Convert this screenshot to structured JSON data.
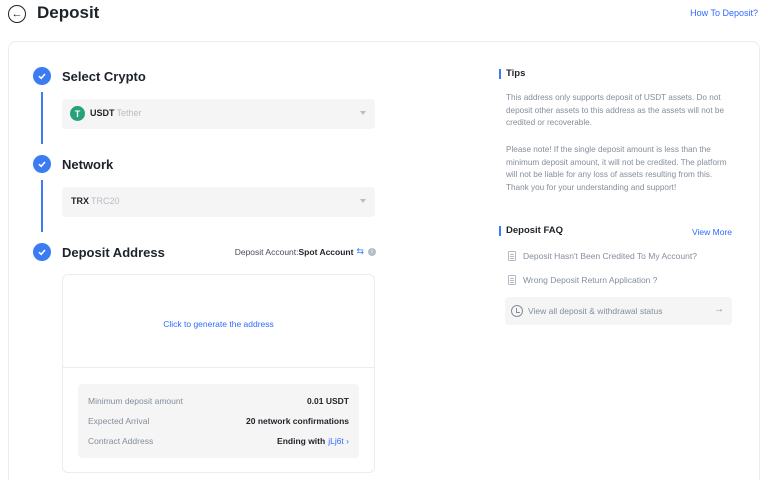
{
  "header": {
    "back_icon": "arrow-left-icon",
    "title": "Deposit",
    "how_to": "How To Deposit?"
  },
  "steps": {
    "select_crypto": {
      "title": "Select Crypto",
      "coin_symbol": "USDT",
      "coin_name": "Tether",
      "coin_icon_glyph": "T",
      "coin_color": "#26a17b"
    },
    "network": {
      "title": "Network",
      "symbol": "TRX",
      "name": "TRC20"
    },
    "deposit_address": {
      "title": "Deposit Address",
      "account_label": "Deposit Account:",
      "account_value": "Spot Account",
      "swap_glyph": "⇆",
      "info_glyph": "i",
      "generate_link": "Click to generate the address",
      "details": [
        {
          "label": "Minimum deposit amount",
          "value": "0.01 USDT"
        },
        {
          "label": "Expected Arrival",
          "value": "20 network confirmations"
        },
        {
          "label": "Contract Address",
          "value": "Ending with",
          "link": "jLj6t ›"
        }
      ]
    }
  },
  "tips": {
    "title": "Tips",
    "p1": "This address only supports deposit of USDT assets. Do not deposit other assets to this address as the assets will not be credited or recoverable.",
    "p2": "Please note! If the single deposit amount is less than the minimum deposit amount, it will not be credited. The platform will not be liable for any loss of assets resulting from this. Thank you for your understanding and support!"
  },
  "faq": {
    "title": "Deposit FAQ",
    "view_more": "View More",
    "items": [
      "Deposit Hasn't Been Credited To My Account?",
      "Wrong Deposit Return Application ?"
    ],
    "status_link": "View all deposit & withdrawal status",
    "status_arrow": "→"
  },
  "colors": {
    "accent": "#3b7cf5",
    "link": "#2f6bff"
  }
}
